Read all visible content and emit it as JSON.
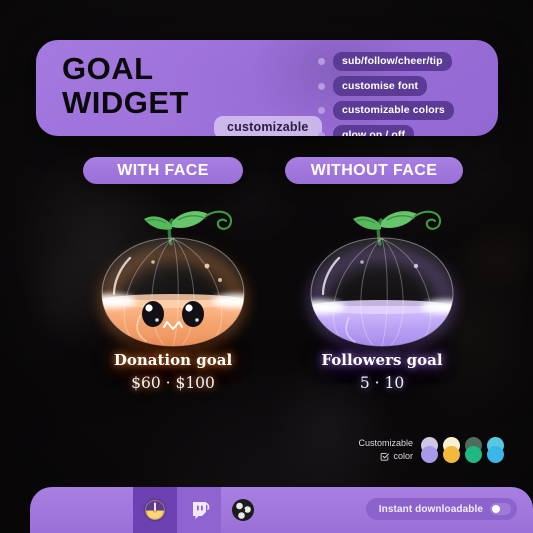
{
  "header": {
    "title": "GOAL\nWIDGET",
    "customizable_pill": "customizable",
    "features": [
      "sub/follow/cheer/tip",
      "customise font",
      "customizable colors",
      "glow on / off"
    ]
  },
  "tabs": [
    {
      "label": "WITH FACE"
    },
    {
      "label": "WITHOUT FACE"
    }
  ],
  "panels": [
    {
      "variant": "with-face",
      "goal_title": "Donation goal",
      "goal_value": "$60 · $100",
      "fill_color": "#f3a06a",
      "glow_color": "#ff8c32",
      "fill_percent": 58,
      "has_face": true
    },
    {
      "variant": "without-face",
      "goal_title": "Followers goal",
      "goal_value": "5 · 10",
      "fill_color": "#b69cf2",
      "glow_color": "#b48cff",
      "fill_percent": 52,
      "has_face": false
    }
  ],
  "customizable_colors": {
    "label_line1": "Customizable",
    "label_line2": "color",
    "icon": "check-square-icon",
    "swatches_top": [
      "#cfc6e4",
      "#f7f0d2",
      "#4e6b5c",
      "#57c8e0"
    ],
    "swatches_bottom": [
      "#a89ae8",
      "#f2b93c",
      "#1fb880",
      "#3ab6e8"
    ]
  },
  "bottom_bar": {
    "platform_icons": [
      {
        "name": "streamelements-icon"
      },
      {
        "name": "twitch-icon"
      },
      {
        "name": "obs-icon"
      }
    ],
    "instant_badge": {
      "label": "Instant downloadable",
      "toggle_on": false
    }
  },
  "theme": {
    "accent_purple": "#9a6fd8",
    "pill_dark_purple": "#5b3b96",
    "background": "#0a0809"
  }
}
